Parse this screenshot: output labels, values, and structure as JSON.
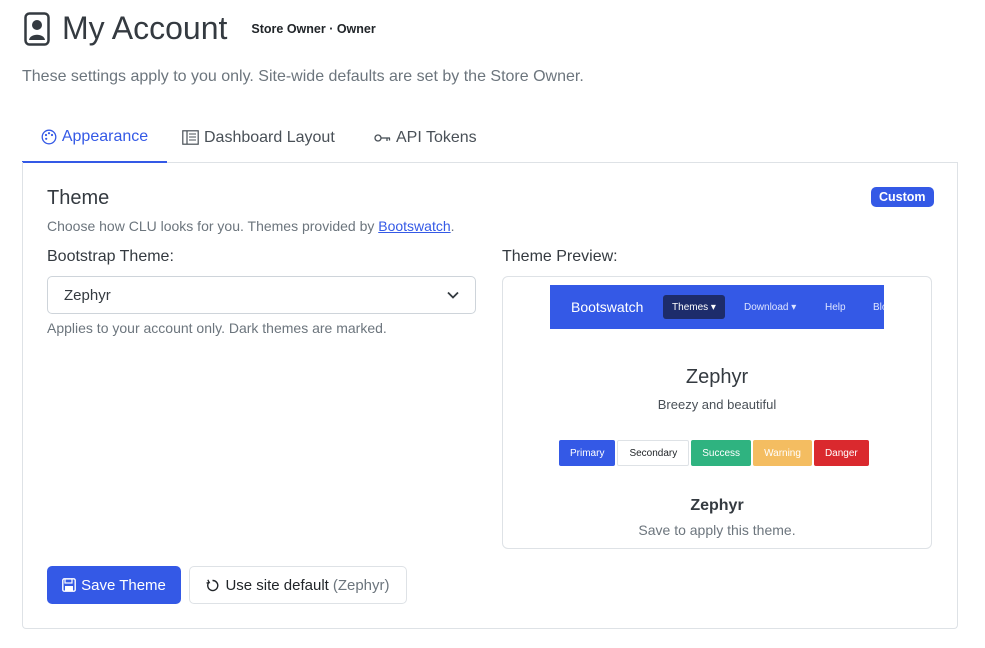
{
  "header": {
    "icon": "account-badge-icon",
    "title": "My Account",
    "role": "Store Owner · Owner",
    "subtitle": "These settings apply to you only. Site-wide defaults are set by the Store Owner."
  },
  "tabs": [
    {
      "label": "Appearance",
      "icon": "palette-icon",
      "active": true
    },
    {
      "label": "Dashboard Layout",
      "icon": "layout-icon",
      "active": false
    },
    {
      "label": "API Tokens",
      "icon": "key-icon",
      "active": false
    }
  ],
  "theme": {
    "title": "Theme",
    "badge": "Custom",
    "description_prefix": "Choose how CLU looks for you. Themes provided by ",
    "description_link": "Bootswatch",
    "description_suffix": ".",
    "select_label": "Bootstrap Theme:",
    "selected": "Zephyr",
    "help": "Applies to your account only. Dark themes are marked.",
    "preview_label": "Theme Preview:"
  },
  "preview": {
    "brand": "Bootswatch",
    "nav_active": "Themes",
    "nav_items": [
      "Download",
      "Help",
      "Blog"
    ],
    "title": "Zephyr",
    "subtitle": "Breezy and beautiful",
    "buttons": [
      {
        "label": "Primary",
        "color": "#3459e6"
      },
      {
        "label": "Secondary",
        "color": "#ffffff"
      },
      {
        "label": "Success",
        "color": "#2fb380"
      },
      {
        "label": "Warning",
        "color": "#f4bd61"
      },
      {
        "label": "Danger",
        "color": "#da292e"
      }
    ],
    "name": "Zephyr",
    "save_hint": "Save to apply this theme."
  },
  "actions": {
    "save_label": "Save Theme",
    "default_label": "Use site default",
    "default_value": "(Zephyr)"
  },
  "colors": {
    "accent": "#3459e6"
  }
}
